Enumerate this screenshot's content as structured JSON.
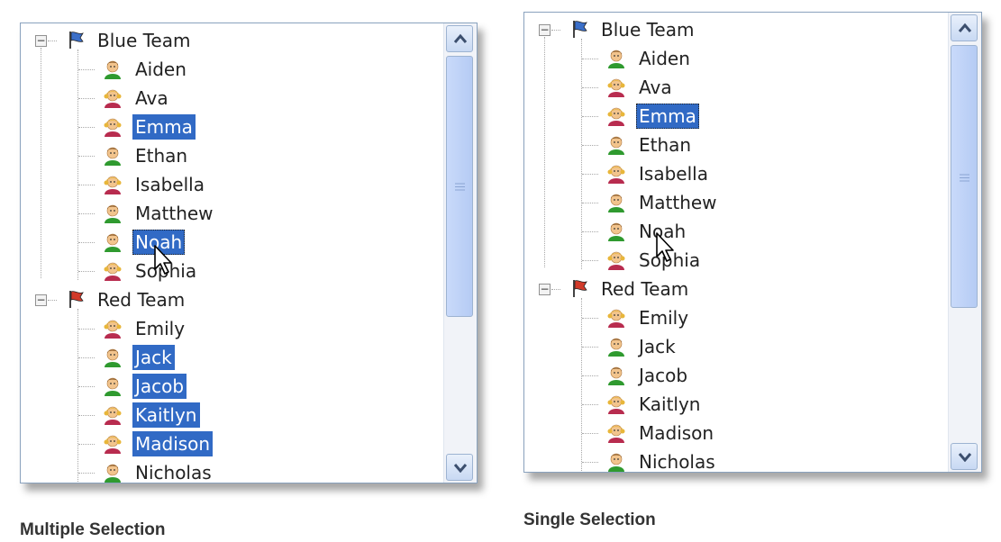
{
  "panels": [
    {
      "id": "multiple",
      "caption": "Multiple Selection",
      "groups": [
        {
          "label": "Blue Team",
          "flag": "blue-flag-icon",
          "members": [
            {
              "name": "Aiden",
              "gender": "boy"
            },
            {
              "name": "Ava",
              "gender": "girl"
            },
            {
              "name": "Emma",
              "gender": "girl",
              "selected": true
            },
            {
              "name": "Ethan",
              "gender": "boy"
            },
            {
              "name": "Isabella",
              "gender": "girl"
            },
            {
              "name": "Matthew",
              "gender": "boy"
            },
            {
              "name": "Noah",
              "gender": "boy",
              "selected": true,
              "focused": true
            },
            {
              "name": "Sophia",
              "gender": "girl"
            }
          ]
        },
        {
          "label": "Red Team",
          "flag": "red-flag-icon",
          "members": [
            {
              "name": "Emily",
              "gender": "girl"
            },
            {
              "name": "Jack",
              "gender": "boy",
              "selected": true
            },
            {
              "name": "Jacob",
              "gender": "boy",
              "selected": true
            },
            {
              "name": "Kaitlyn",
              "gender": "girl",
              "selected": true
            },
            {
              "name": "Madison",
              "gender": "girl",
              "selected": true
            },
            {
              "name": "Nicholas",
              "gender": "boy"
            }
          ]
        }
      ]
    },
    {
      "id": "single",
      "caption": "Single Selection",
      "groups": [
        {
          "label": "Blue Team",
          "flag": "blue-flag-icon",
          "members": [
            {
              "name": "Aiden",
              "gender": "boy"
            },
            {
              "name": "Ava",
              "gender": "girl"
            },
            {
              "name": "Emma",
              "gender": "girl",
              "selected": true,
              "focused": true
            },
            {
              "name": "Ethan",
              "gender": "boy"
            },
            {
              "name": "Isabella",
              "gender": "girl"
            },
            {
              "name": "Matthew",
              "gender": "boy"
            },
            {
              "name": "Noah",
              "gender": "boy"
            },
            {
              "name": "Sophia",
              "gender": "girl"
            }
          ]
        },
        {
          "label": "Red Team",
          "flag": "red-flag-icon",
          "members": [
            {
              "name": "Emily",
              "gender": "girl"
            },
            {
              "name": "Jack",
              "gender": "boy"
            },
            {
              "name": "Jacob",
              "gender": "boy"
            },
            {
              "name": "Kaitlyn",
              "gender": "girl"
            },
            {
              "name": "Madison",
              "gender": "girl"
            },
            {
              "name": "Nicholas",
              "gender": "boy"
            }
          ]
        }
      ]
    }
  ],
  "icons": {
    "expanded_toggle": "minus-toggle-icon",
    "scroll_up": "chevron-up-icon",
    "scroll_down": "chevron-down-icon",
    "scroll_grip": "scroll-grip-icon",
    "pointer": "mouse-pointer-icon"
  },
  "colors": {
    "selection": "#316ac5",
    "selection_text": "#ffffff",
    "border": "#8aa2be",
    "blue_flag": "#3b6fc9",
    "red_flag": "#d23a2a",
    "boy_shirt": "#2f9a2f",
    "girl_shirt": "#b82c4f"
  }
}
